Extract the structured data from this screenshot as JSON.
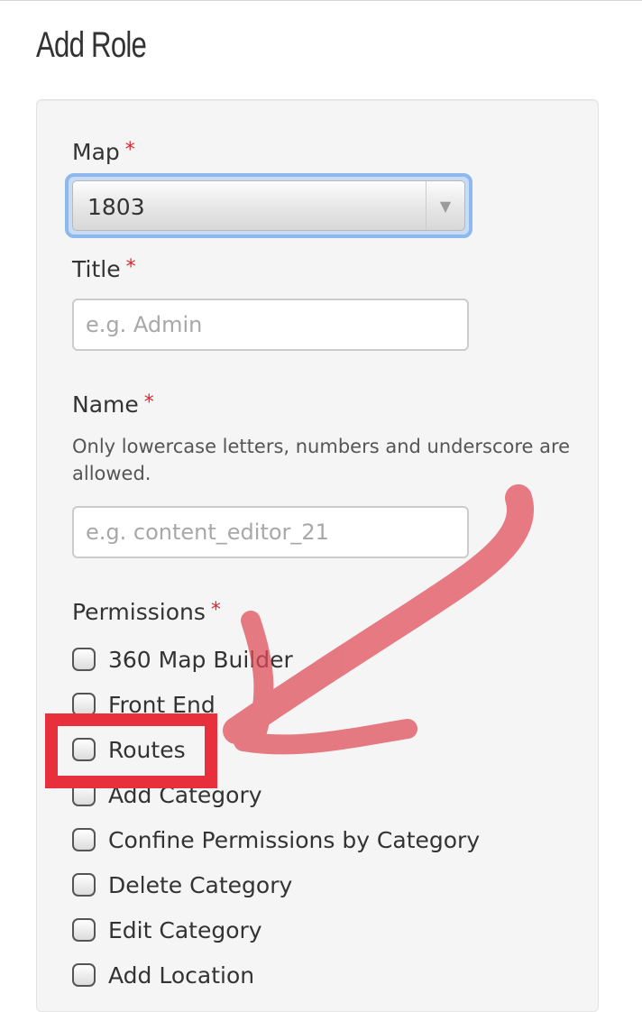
{
  "page": {
    "title": "Add Role"
  },
  "form": {
    "required_mark": "*",
    "map": {
      "label": "Map",
      "selected": "1803"
    },
    "title": {
      "label": "Title",
      "placeholder": "e.g. Admin",
      "value": ""
    },
    "name": {
      "label": "Name",
      "help": "Only lowercase letters, numbers and underscore are allowed.",
      "placeholder": "e.g. content_editor_21",
      "value": ""
    },
    "permissions": {
      "label": "Permissions",
      "items": [
        {
          "label": "360 Map Builder",
          "checked": false
        },
        {
          "label": "Front End",
          "checked": false
        },
        {
          "label": "Routes",
          "checked": false
        },
        {
          "label": "Add Category",
          "checked": false
        },
        {
          "label": "Confine Permissions by Category",
          "checked": false
        },
        {
          "label": "Delete Category",
          "checked": false
        },
        {
          "label": "Edit Category",
          "checked": false
        },
        {
          "label": "Add Location",
          "checked": false
        }
      ]
    }
  },
  "annotation": {
    "arrow_color": "#e04a55",
    "box_color": "#e8303d",
    "highlighted_item": "Routes"
  },
  "icons": {
    "select_arrow": "chevron-down-icon"
  },
  "colors": {
    "required": "#d9282f",
    "focus_ring": "#8fb8ef",
    "card_bg": "#f5f5f5"
  }
}
